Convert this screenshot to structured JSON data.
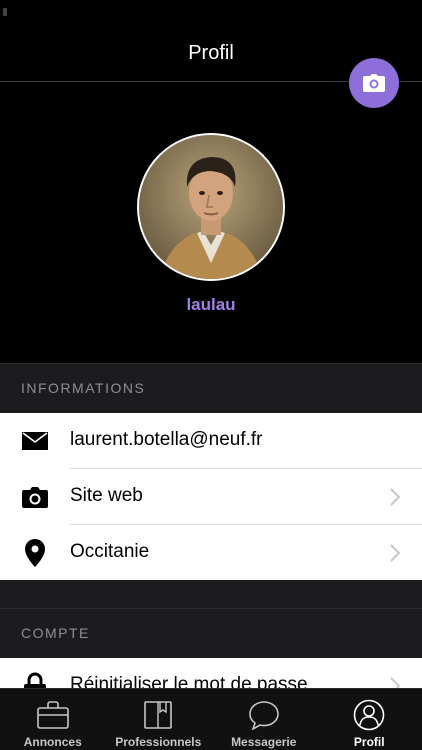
{
  "header": {
    "title": "Profil"
  },
  "profile": {
    "username": "laulau"
  },
  "sections": {
    "informations": {
      "title": "INFORMATIONS",
      "rows": [
        {
          "label": "laurent.botella@neuf.fr",
          "icon": "envelope-icon"
        },
        {
          "label": "Site web",
          "icon": "camera-icon"
        },
        {
          "label": "Occitanie",
          "icon": "location-pin-icon"
        }
      ]
    },
    "compte": {
      "title": "COMPTE",
      "rows": [
        {
          "label": "Réinitialiser le mot de passe",
          "icon": "lock-icon"
        }
      ]
    }
  },
  "tabbar": {
    "tabs": [
      {
        "label": "Annonces",
        "icon": "briefcase-icon",
        "active": false
      },
      {
        "label": "Professionnels",
        "icon": "book-icon",
        "active": false
      },
      {
        "label": "Messagerie",
        "icon": "chat-bubble-icon",
        "active": false
      },
      {
        "label": "Profil",
        "icon": "user-icon",
        "active": true
      }
    ]
  },
  "colors": {
    "accent": "#8e6fd9",
    "username": "#9f7fe8",
    "background": "#000000",
    "section_header": "#1c1c1e"
  }
}
